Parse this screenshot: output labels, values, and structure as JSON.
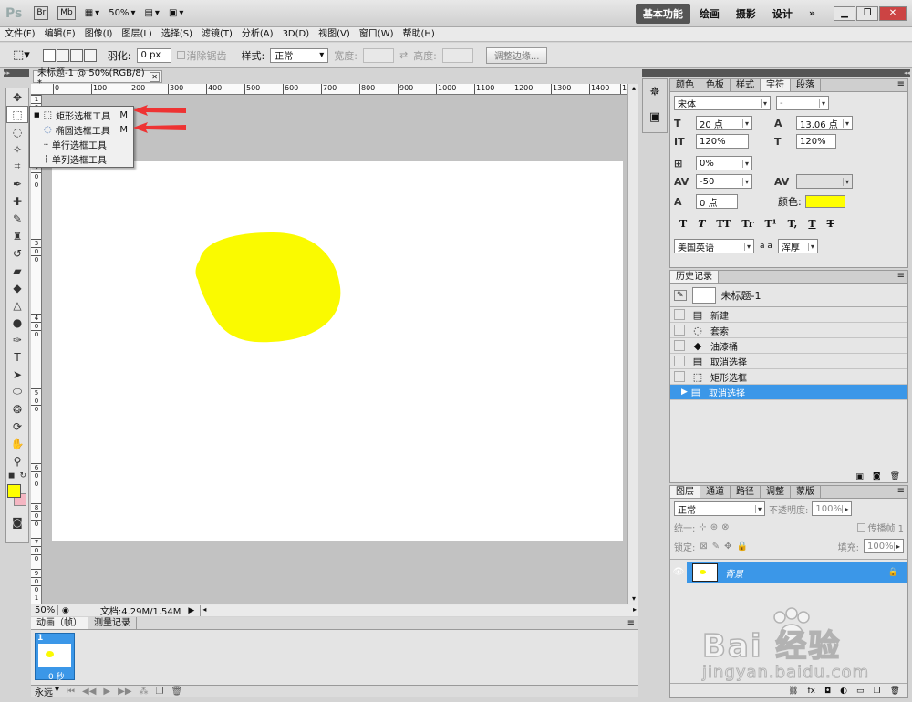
{
  "titlebar": {
    "app_logo": "Ps",
    "bridge": "Br",
    "minibridge": "Mb",
    "zoom": "50%",
    "workspaces": [
      "基本功能",
      "绘画",
      "摄影",
      "设计"
    ],
    "more": "»"
  },
  "menu": [
    "文件(F)",
    "编辑(E)",
    "图像(I)",
    "图层(L)",
    "选择(S)",
    "滤镜(T)",
    "分析(A)",
    "3D(D)",
    "视图(V)",
    "窗口(W)",
    "帮助(H)"
  ],
  "options": {
    "feather_label": "羽化:",
    "feather_value": "0 px",
    "antialias": "消除锯齿",
    "style_label": "样式:",
    "style_value": "正常",
    "width_label": "宽度:",
    "height_label": "高度:",
    "refine": "调整边缘..."
  },
  "document": {
    "tab_title": "未标题-1 @ 50%(RGB/8) *",
    "zoom": "50%",
    "doc_info": "文档:4.29M/1.54M",
    "ruler_h": [
      "0",
      "100",
      "200",
      "300",
      "400",
      "500",
      "600",
      "700",
      "800",
      "900",
      "1000",
      "1100",
      "1200",
      "1300",
      "1400",
      "15"
    ],
    "ruler_v": [
      "1",
      "0",
      "0",
      "2",
      "0",
      "0",
      "3",
      "0",
      "0",
      "4",
      "0",
      "0",
      "5",
      "0",
      "0",
      "6",
      "0",
      "0",
      "7",
      "0",
      "0",
      "8",
      "0",
      "0",
      "9",
      "0",
      "0",
      "1"
    ]
  },
  "flyout": {
    "items": [
      {
        "label": "矩形选框工具",
        "key": "M"
      },
      {
        "label": "椭圆选框工具",
        "key": "M"
      },
      {
        "label": "单行选框工具",
        "key": ""
      },
      {
        "label": "单列选框工具",
        "key": ""
      }
    ]
  },
  "colors": {
    "foreground": "#ffff00",
    "background": "#f4b6c2",
    "blob": "#fafa00",
    "accent": "#3b97e8"
  },
  "char_panel": {
    "tabs": [
      "颜色",
      "色板",
      "样式",
      "字符",
      "段落"
    ],
    "active_tab": "字符",
    "font_family": "宋体",
    "font_style": "-",
    "font_size": "20 点",
    "leading": "13.06 点",
    "vscale": "120%",
    "hscale": "120%",
    "tracking_pct": "0%",
    "kerning": "-50",
    "baseline": "0 点",
    "color_label": "颜色:",
    "language": "美国英语",
    "aa": "浑厚",
    "aa_label": "a a",
    "text_styles": [
      "T",
      "T",
      "TT",
      "Tr",
      "T¹",
      "T,",
      "T",
      "T"
    ]
  },
  "history": {
    "tab": "历史记录",
    "snapshot": "未标题-1",
    "items": [
      "新建",
      "套索",
      "油漆桶",
      "取消选择",
      "矩形选框",
      "取消选择"
    ]
  },
  "layers": {
    "tabs": [
      "图层",
      "通道",
      "路径",
      "调整",
      "蒙版"
    ],
    "blend": "正常",
    "opacity_label": "不透明度:",
    "opacity": "100%",
    "unify_label": "统一:",
    "propagate": "传播帧 1",
    "lock_label": "锁定:",
    "fill_label": "填充:",
    "fill": "100%",
    "layer_name": "背景"
  },
  "animation": {
    "tabs": [
      "动画（帧）",
      "测量记录"
    ],
    "frame_number": "1",
    "frame_time": "0 秒",
    "loop": "永远"
  },
  "watermark": {
    "brand_text": "Bai 经验",
    "url": "jingyan.baidu.com"
  }
}
